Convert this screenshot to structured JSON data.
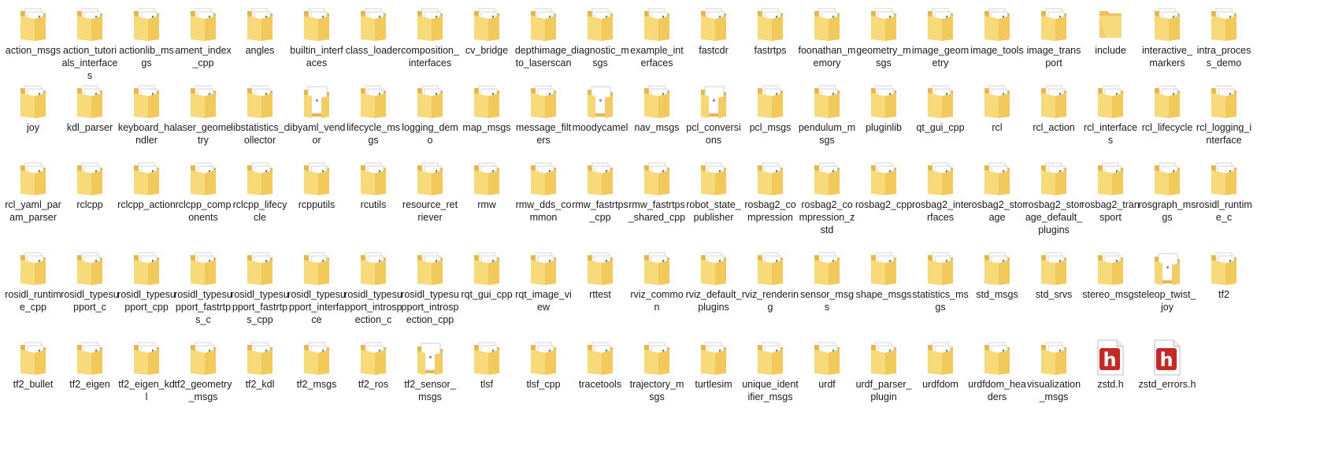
{
  "items": [
    {
      "name": "action_msgs",
      "type": "folder"
    },
    {
      "name": "action_tutorials_interfaces",
      "type": "folder"
    },
    {
      "name": "actionlib_msgs",
      "type": "folder"
    },
    {
      "name": "ament_index_cpp",
      "type": "folder"
    },
    {
      "name": "angles",
      "type": "folder"
    },
    {
      "name": "builtin_interfaces",
      "type": "folder"
    },
    {
      "name": "class_loader",
      "type": "folder"
    },
    {
      "name": "composition_interfaces",
      "type": "folder"
    },
    {
      "name": "cv_bridge",
      "type": "folder"
    },
    {
      "name": "depthimage_to_laserscan",
      "type": "folder"
    },
    {
      "name": "diagnostic_msgs",
      "type": "folder"
    },
    {
      "name": "example_interfaces",
      "type": "folder"
    },
    {
      "name": "fastcdr",
      "type": "folder"
    },
    {
      "name": "fastrtps",
      "type": "folder"
    },
    {
      "name": "foonathan_memory",
      "type": "folder"
    },
    {
      "name": "geometry_msgs",
      "type": "folder"
    },
    {
      "name": "image_geometry",
      "type": "folder"
    },
    {
      "name": "image_tools",
      "type": "folder"
    },
    {
      "name": "image_transport",
      "type": "folder"
    },
    {
      "name": "include",
      "type": "folder-empty"
    },
    {
      "name": "interactive_markers",
      "type": "folder"
    },
    {
      "name": "intra_process_demo",
      "type": "folder"
    },
    {
      "name": "joy",
      "type": "folder"
    },
    {
      "name": "kdl_parser",
      "type": "folder"
    },
    {
      "name": "keyboard_handler",
      "type": "folder"
    },
    {
      "name": "laser_geometry",
      "type": "folder"
    },
    {
      "name": "libstatistics_collector",
      "type": "folder"
    },
    {
      "name": "libyaml_vendor",
      "type": "folder-doc"
    },
    {
      "name": "lifecycle_msgs",
      "type": "folder"
    },
    {
      "name": "logging_demo",
      "type": "folder"
    },
    {
      "name": "map_msgs",
      "type": "folder"
    },
    {
      "name": "message_filters",
      "type": "folder"
    },
    {
      "name": "moodycamel",
      "type": "folder-doc"
    },
    {
      "name": "nav_msgs",
      "type": "folder"
    },
    {
      "name": "pcl_conversions",
      "type": "folder-doc"
    },
    {
      "name": "pcl_msgs",
      "type": "folder"
    },
    {
      "name": "pendulum_msgs",
      "type": "folder"
    },
    {
      "name": "pluginlib",
      "type": "folder"
    },
    {
      "name": "qt_gui_cpp",
      "type": "folder"
    },
    {
      "name": "rcl",
      "type": "folder"
    },
    {
      "name": "rcl_action",
      "type": "folder"
    },
    {
      "name": "rcl_interfaces",
      "type": "folder"
    },
    {
      "name": "rcl_lifecycle",
      "type": "folder"
    },
    {
      "name": "rcl_logging_interface",
      "type": "folder"
    },
    {
      "name": "rcl_yaml_param_parser",
      "type": "folder"
    },
    {
      "name": "rclcpp",
      "type": "folder"
    },
    {
      "name": "rclcpp_action",
      "type": "folder"
    },
    {
      "name": "rclcpp_components",
      "type": "folder"
    },
    {
      "name": "rclcpp_lifecycle",
      "type": "folder"
    },
    {
      "name": "rcpputils",
      "type": "folder"
    },
    {
      "name": "rcutils",
      "type": "folder"
    },
    {
      "name": "resource_retriever",
      "type": "folder"
    },
    {
      "name": "rmw",
      "type": "folder"
    },
    {
      "name": "rmw_dds_common",
      "type": "folder"
    },
    {
      "name": "rmw_fastrtps_cpp",
      "type": "folder"
    },
    {
      "name": "rmw_fastrtps_shared_cpp",
      "type": "folder"
    },
    {
      "name": "robot_state_publisher",
      "type": "folder"
    },
    {
      "name": "rosbag2_compression",
      "type": "folder"
    },
    {
      "name": "rosbag2_compression_zstd",
      "type": "folder"
    },
    {
      "name": "rosbag2_cpp",
      "type": "folder"
    },
    {
      "name": "rosbag2_interfaces",
      "type": "folder"
    },
    {
      "name": "rosbag2_storage",
      "type": "folder"
    },
    {
      "name": "rosbag2_storage_default_plugins",
      "type": "folder"
    },
    {
      "name": "rosbag2_transport",
      "type": "folder"
    },
    {
      "name": "rosgraph_msgs",
      "type": "folder"
    },
    {
      "name": "rosidl_runtime_c",
      "type": "folder"
    },
    {
      "name": "rosidl_runtime_cpp",
      "type": "folder"
    },
    {
      "name": "rosidl_typesupport_c",
      "type": "folder"
    },
    {
      "name": "rosidl_typesupport_cpp",
      "type": "folder"
    },
    {
      "name": "rosidl_typesupport_fastrtps_c",
      "type": "folder"
    },
    {
      "name": "rosidl_typesupport_fastrtps_cpp",
      "type": "folder"
    },
    {
      "name": "rosidl_typesupport_interface",
      "type": "folder"
    },
    {
      "name": "rosidl_typesupport_introspection_c",
      "type": "folder"
    },
    {
      "name": "rosidl_typesupport_introspection_cpp",
      "type": "folder"
    },
    {
      "name": "rqt_gui_cpp",
      "type": "folder"
    },
    {
      "name": "rqt_image_view",
      "type": "folder"
    },
    {
      "name": "rttest",
      "type": "folder"
    },
    {
      "name": "rviz_common",
      "type": "folder"
    },
    {
      "name": "rviz_default_plugins",
      "type": "folder"
    },
    {
      "name": "rviz_rendering",
      "type": "folder"
    },
    {
      "name": "sensor_msgs",
      "type": "folder"
    },
    {
      "name": "shape_msgs",
      "type": "folder"
    },
    {
      "name": "statistics_msgs",
      "type": "folder"
    },
    {
      "name": "std_msgs",
      "type": "folder"
    },
    {
      "name": "std_srvs",
      "type": "folder"
    },
    {
      "name": "stereo_msgs",
      "type": "folder"
    },
    {
      "name": "teleop_twist_joy",
      "type": "folder-doc"
    },
    {
      "name": "tf2",
      "type": "folder"
    },
    {
      "name": "tf2_bullet",
      "type": "folder"
    },
    {
      "name": "tf2_eigen",
      "type": "folder"
    },
    {
      "name": "tf2_eigen_kdl",
      "type": "folder"
    },
    {
      "name": "tf2_geometry_msgs",
      "type": "folder"
    },
    {
      "name": "tf2_kdl",
      "type": "folder"
    },
    {
      "name": "tf2_msgs",
      "type": "folder"
    },
    {
      "name": "tf2_ros",
      "type": "folder"
    },
    {
      "name": "tf2_sensor_msgs",
      "type": "folder-doc"
    },
    {
      "name": "tlsf",
      "type": "folder"
    },
    {
      "name": "tlsf_cpp",
      "type": "folder"
    },
    {
      "name": "tracetools",
      "type": "folder"
    },
    {
      "name": "trajectory_msgs",
      "type": "folder"
    },
    {
      "name": "turtlesim",
      "type": "folder"
    },
    {
      "name": "unique_identifier_msgs",
      "type": "folder"
    },
    {
      "name": "urdf",
      "type": "folder"
    },
    {
      "name": "urdf_parser_plugin",
      "type": "folder"
    },
    {
      "name": "urdfdom",
      "type": "folder"
    },
    {
      "name": "urdfdom_headers",
      "type": "folder"
    },
    {
      "name": "visualization_msgs",
      "type": "folder"
    },
    {
      "name": "zstd.h",
      "type": "h-file"
    },
    {
      "name": "zstd_errors.h",
      "type": "h-file"
    }
  ],
  "colors": {
    "folder": "#f7d774",
    "folder_dark": "#e9b949",
    "hfile_accent": "#c62828"
  }
}
